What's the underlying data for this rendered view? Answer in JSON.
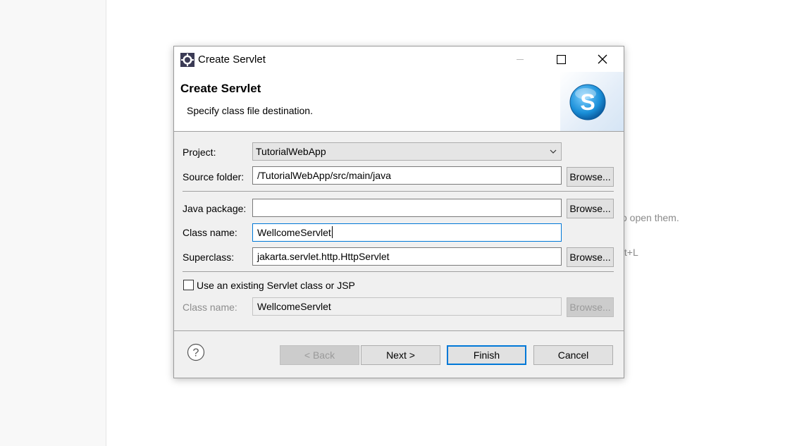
{
  "background": {
    "hint_open": "o open them.",
    "hint_shortcut": "ft+L"
  },
  "window": {
    "title": "Create Servlet",
    "minimize_icon": "minimize-icon",
    "maximize_icon": "maximize-icon",
    "close_icon": "close-icon"
  },
  "banner": {
    "title": "Create Servlet",
    "subtitle": "Specify class file destination.",
    "logo_letter": "S"
  },
  "form": {
    "project_label": "Project:",
    "project_value": "TutorialWebApp",
    "source_folder_label": "Source folder:",
    "source_folder_value": "/TutorialWebApp/src/main/java",
    "java_package_label": "Java package:",
    "java_package_value": "",
    "class_name_label": "Class name:",
    "class_name_value": "WellcomeServlet",
    "superclass_label": "Superclass:",
    "superclass_value": "jakarta.servlet.http.HttpServlet",
    "browse_label": "Browse...",
    "existing_checkbox_label": "Use an existing Servlet class or JSP",
    "existing_checked": false,
    "existing_class_label": "Class name:",
    "existing_class_value": "WellcomeServlet"
  },
  "footer": {
    "help_icon": "help-icon",
    "back_label": "< Back",
    "next_label": "Next >",
    "finish_label": "Finish",
    "cancel_label": "Cancel"
  },
  "colors": {
    "focus": "#0078d7",
    "logo": "#1a8fd8"
  }
}
